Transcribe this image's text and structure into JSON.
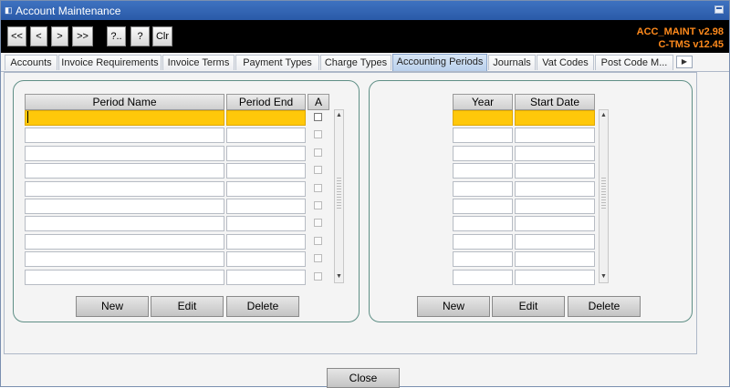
{
  "window": {
    "title": "Account Maintenance"
  },
  "toolbar": {
    "buttons": [
      "<<",
      "<",
      ">",
      ">>",
      "?..",
      "?",
      "Clr"
    ],
    "version_line1": "ACC_MAINT v2.98",
    "version_line2": "C-TMS v12.45"
  },
  "tabs": [
    "Accounts",
    "Invoice Requirements",
    "Invoice Terms",
    "Payment Types",
    "Charge Types",
    "Accounting Periods",
    "Journals",
    "Vat Codes",
    "Post Code M..."
  ],
  "active_tab": "Accounting Periods",
  "periods": {
    "columns": [
      "Period Name",
      "Period End",
      "A"
    ],
    "rows": 10,
    "buttons": {
      "new": "New",
      "edit": "Edit",
      "delete": "Delete"
    }
  },
  "years": {
    "columns": [
      "Year",
      "Start Date"
    ],
    "rows": 10,
    "buttons": {
      "new": "New",
      "edit": "Edit",
      "delete": "Delete"
    }
  },
  "footer": {
    "close_label": "Close"
  },
  "colors": {
    "selected_row": "#ffc80a",
    "version_text": "#ff8a1c",
    "panel_border": "#5f8f86"
  }
}
